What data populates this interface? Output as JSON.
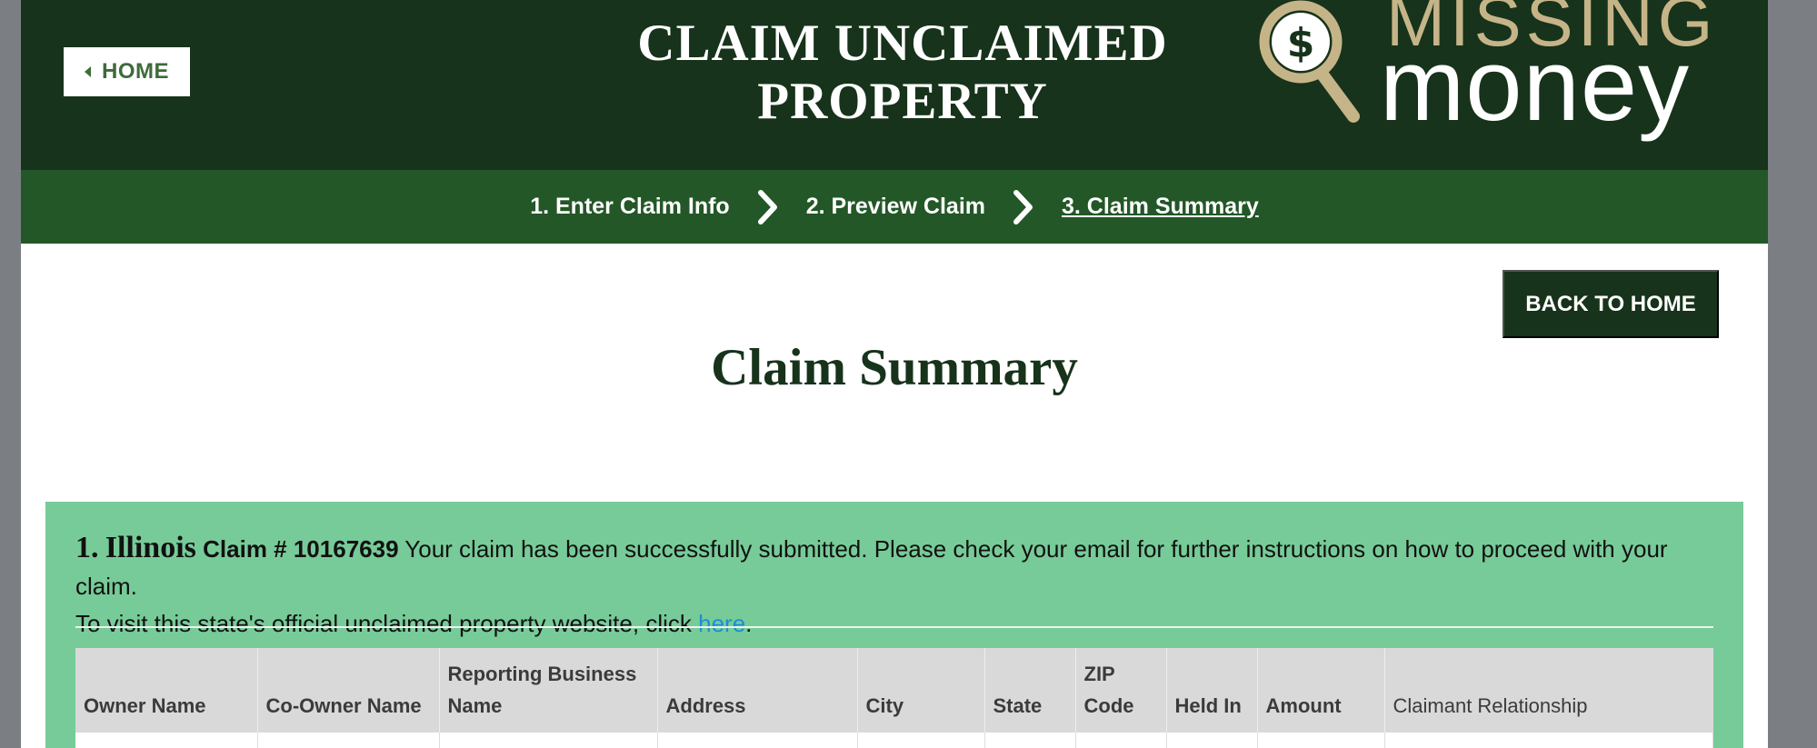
{
  "header": {
    "home_label": "HOME",
    "site_title": "CLAIM UNCLAIMED PROPERTY",
    "logo": {
      "line1": "MISSING",
      "line2": "money",
      "icon": "magnifier-dollar-icon"
    }
  },
  "stepper": {
    "steps": [
      {
        "label": "1. Enter Claim Info",
        "active": false
      },
      {
        "label": "2. Preview Claim",
        "active": false
      },
      {
        "label": "3. Claim Summary",
        "active": true
      }
    ]
  },
  "actions": {
    "back_home_label": "BACK TO HOME"
  },
  "main": {
    "heading": "Claim Summary"
  },
  "claim": {
    "number_label": "1.",
    "state": "Illinois",
    "claim_number_text": "Claim # 10167639",
    "message": "Your claim has been successfully submitted. Please check your email for further instructions on how to proceed with your claim.",
    "visit_text": "To visit this state's official unclaimed property website, click",
    "link_text": "here",
    "link_suffix": ".",
    "table": {
      "columns": [
        "Owner Name",
        "Co-Owner Name",
        "Reporting Business Name",
        "Address",
        "City",
        "State",
        "ZIP Code",
        "Held In",
        "Amount",
        "Claimant Relationship"
      ]
    }
  },
  "colors": {
    "header_bg": "#17331b",
    "stepper_bg": "#235727",
    "panel_bg": "#77cb98",
    "link": "#1a8fd6",
    "logo_gold": "#c6b489"
  }
}
